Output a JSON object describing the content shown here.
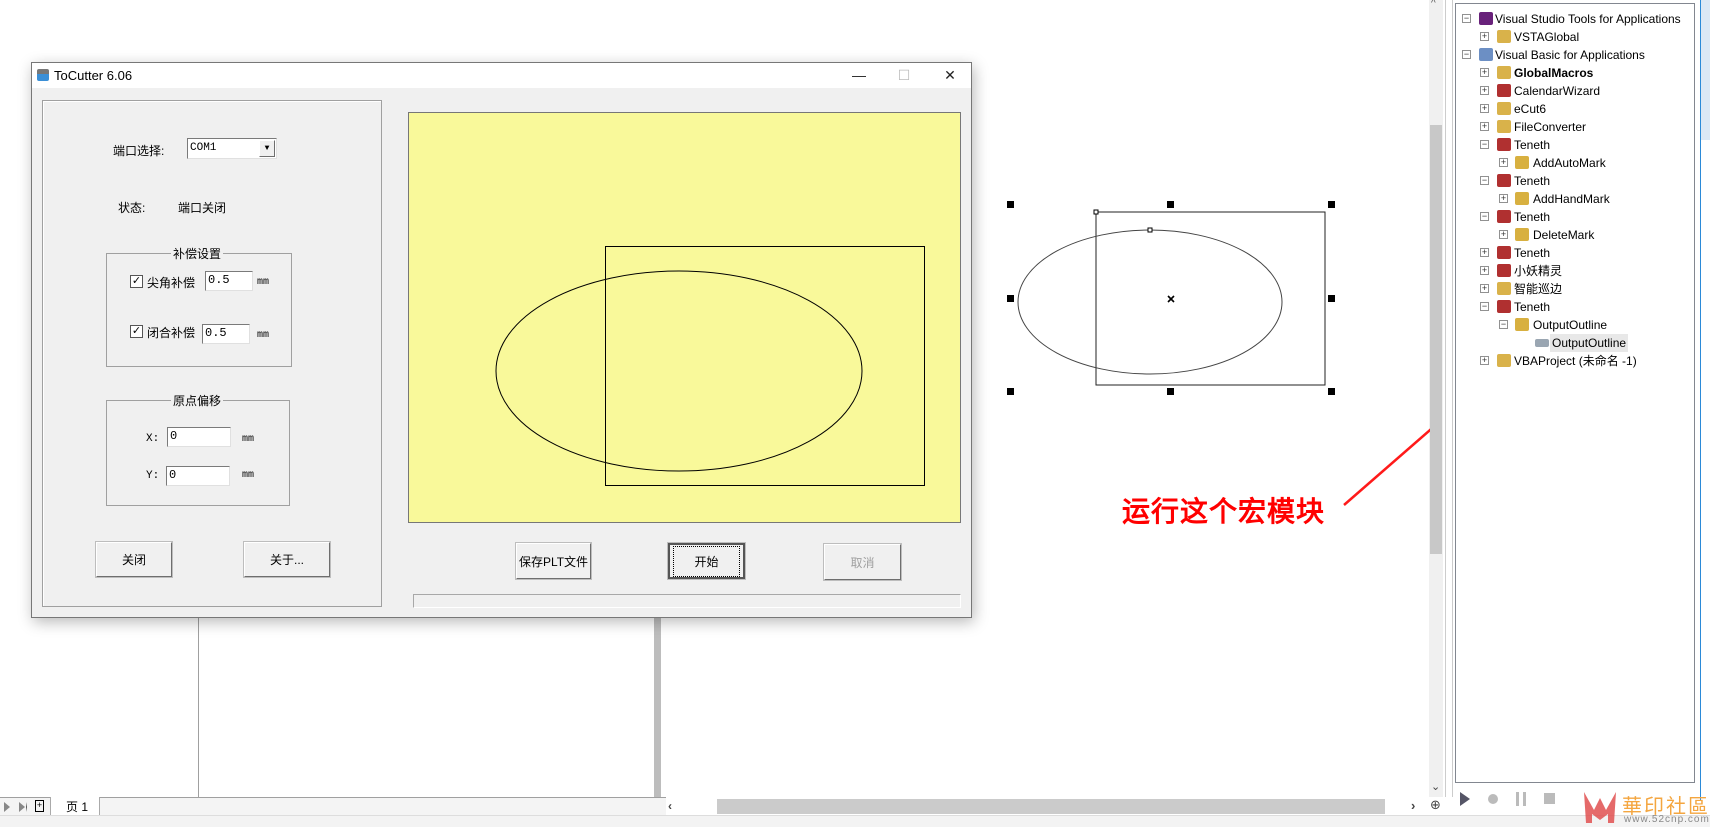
{
  "window": {
    "title": "ToCutter 6.06",
    "minimize": "—",
    "maximize": "☐",
    "close": "✕",
    "port_label": "端口选择:",
    "port_value": "COM1",
    "status_label": "状态:",
    "status_value": "端口关闭",
    "comp_group_title": "补偿设置",
    "corner_comp_label": "尖角补偿",
    "corner_comp_checked": true,
    "corner_comp_value": "0.5",
    "close_comp_label": "闭合补偿",
    "close_comp_checked": true,
    "close_comp_value": "0.5",
    "unit": "mm",
    "origin_group_title": "原点偏移",
    "x_label": "X:",
    "x_value": "0",
    "y_label": "Y:",
    "y_value": "0",
    "close_button": "关闭",
    "about_button": "关于...",
    "save_plt_button": "保存PLT文件",
    "start_button": "开始",
    "cancel_button": "取消",
    "progress": 0,
    "preview_bg": "#f9f99a"
  },
  "tree": [
    {
      "label": "Visual Studio Tools for Applications",
      "level": 0,
      "exp": "-",
      "icon": "vs"
    },
    {
      "label": "VSTAGlobal",
      "level": 1,
      "exp": "+",
      "icon": "proj"
    },
    {
      "label": "Visual Basic for Applications",
      "level": 0,
      "exp": "-",
      "icon": "vba"
    },
    {
      "label": "GlobalMacros",
      "level": 1,
      "exp": "+",
      "icon": "proj",
      "bold": true
    },
    {
      "label": "CalendarWizard",
      "level": 1,
      "exp": "+",
      "icon": "lock"
    },
    {
      "label": "eCut6",
      "level": 1,
      "exp": "+",
      "icon": "proj"
    },
    {
      "label": "FileConverter",
      "level": 1,
      "exp": "+",
      "icon": "proj"
    },
    {
      "label": "Teneth",
      "level": 1,
      "exp": "-",
      "icon": "lock"
    },
    {
      "label": "AddAutoMark",
      "level": 2,
      "exp": "+",
      "icon": "module"
    },
    {
      "label": "Teneth",
      "level": 1,
      "exp": "-",
      "icon": "lock"
    },
    {
      "label": "AddHandMark",
      "level": 2,
      "exp": "+",
      "icon": "module"
    },
    {
      "label": "Teneth",
      "level": 1,
      "exp": "-",
      "icon": "lock"
    },
    {
      "label": "DeleteMark",
      "level": 2,
      "exp": "+",
      "icon": "module"
    },
    {
      "label": "Teneth",
      "level": 1,
      "exp": "+",
      "icon": "lock"
    },
    {
      "label": "小妖精灵",
      "level": 1,
      "exp": "+",
      "icon": "lock"
    },
    {
      "label": "智能巡边",
      "level": 1,
      "exp": "+",
      "icon": "proj"
    },
    {
      "label": "Teneth",
      "level": 1,
      "exp": "-",
      "icon": "lock"
    },
    {
      "label": "OutputOutline",
      "level": 2,
      "exp": "-",
      "icon": "module"
    },
    {
      "label": "OutputOutline",
      "level": 3,
      "exp": "",
      "icon": "macro",
      "selected": true
    },
    {
      "label": "VBAProject (未命名 -1)",
      "level": 1,
      "exp": "+",
      "icon": "proj"
    }
  ],
  "annotation": {
    "text": "运行这个宏模块",
    "color": "#ff0000"
  },
  "bottom": {
    "page_tab": "页 1"
  },
  "watermark": {
    "logo": "華印社區",
    "url": "www.52cnp.com"
  }
}
